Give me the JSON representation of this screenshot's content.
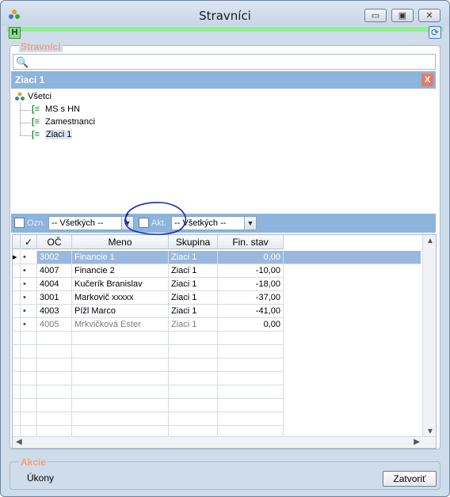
{
  "window": {
    "title": "Stravníci"
  },
  "toolbar": {
    "h_label": "H"
  },
  "group": {
    "label": "Stravníci"
  },
  "search": {
    "value": "",
    "placeholder": ""
  },
  "filter": {
    "title": "Ziaci 1",
    "clear_label": "X"
  },
  "tree": {
    "root": "Všetci",
    "children": [
      "MS s HN",
      "Zamestnanci",
      "Ziaci 1"
    ],
    "selected": "Ziaci 1"
  },
  "bottom_filter": {
    "ozn_label": "Ozn.",
    "ozn_value": "-- Všetkých --",
    "akt_label": "Akt.",
    "akt_value": "-- Všetkých --"
  },
  "grid": {
    "columns": [
      "",
      "OČ",
      "Meno",
      "Skupina",
      "Fin. stav"
    ],
    "rows": [
      {
        "oc": "3002",
        "meno": "Financie 1",
        "skupina": "Ziaci 1",
        "fin": "0,00"
      },
      {
        "oc": "4007",
        "meno": "Financie 2",
        "skupina": "Ziaci 1",
        "fin": "-10,00"
      },
      {
        "oc": "4004",
        "meno": "Kučerík Branislav",
        "skupina": "Ziaci 1",
        "fin": "-18,00"
      },
      {
        "oc": "3001",
        "meno": "Markovič xxxxx",
        "skupina": "Ziaci 1",
        "fin": "-37,00"
      },
      {
        "oc": "4003",
        "meno": "Pížl Marco",
        "skupina": "Ziaci 1",
        "fin": "-41,00"
      },
      {
        "oc": "4005",
        "meno": "Mrkvičková Ester",
        "skupina": "Ziaci 1",
        "fin": "0,00"
      }
    ]
  },
  "actions": {
    "label": "Akcie",
    "ukony": "Úkony",
    "close": "Zatvoriť"
  },
  "colors": {
    "accent": "#8cb4dc",
    "label": "#f0a080",
    "green": "#90f090"
  }
}
